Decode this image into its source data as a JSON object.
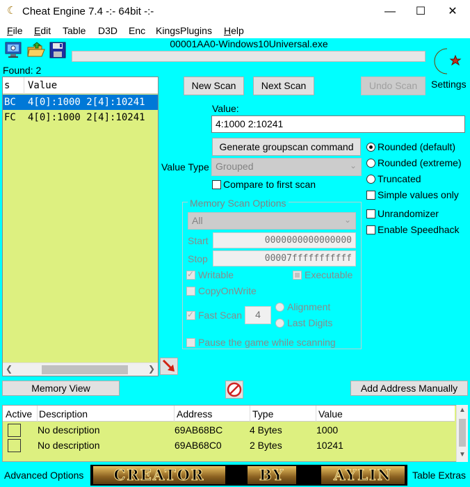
{
  "window": {
    "title": "Cheat Engine 7.4 -:- 64bit -:-",
    "minimize": "—",
    "maximize": "☐",
    "close": "✕"
  },
  "menu": [
    {
      "label": "File",
      "accel": "F",
      "rest": "ile"
    },
    {
      "label": "Edit",
      "accel": "E",
      "rest": "dit"
    },
    {
      "label": "Table",
      "accel": "",
      "rest": "Table"
    },
    {
      "label": "D3D",
      "accel": "",
      "rest": "D3D"
    },
    {
      "label": "Enc",
      "accel": "",
      "rest": "Enc"
    },
    {
      "label": "KingsPlugins",
      "accel": "",
      "rest": "KingsPlugins"
    },
    {
      "label": "Help",
      "accel": "H",
      "rest": "elp"
    }
  ],
  "toolbar": {
    "process_title": "00001AA0-Windows10Universal.exe",
    "settings_label": "Settings"
  },
  "scan": {
    "found_label": "Found: 2",
    "results_headers": [
      "s",
      "Value"
    ],
    "results": [
      {
        "type": "BC",
        "value": "4[0]:1000 2[4]:10241",
        "selected": true
      },
      {
        "type": "FC",
        "value": "4[0]:1000 2[4]:10241",
        "selected": false
      }
    ],
    "new_scan": "New Scan",
    "next_scan": "Next Scan",
    "undo_scan": "Undo Scan",
    "value_label": "Value:",
    "value_input": "4:1000 2:10241",
    "groupscan_btn": "Generate groupscan command",
    "value_type_label": "Value Type",
    "value_type": "Grouped",
    "compare_first": "Compare to first scan",
    "mem_options_title": "Memory Scan Options",
    "mem_region": "All",
    "start_label": "Start",
    "start_value": "0000000000000000",
    "stop_label": "Stop",
    "stop_value": "00007fffffffffff",
    "writable": "Writable",
    "executable": "Executable",
    "copy_on_write": "CopyOnWrite",
    "fast_scan": "Fast Scan",
    "fast_scan_value": "4",
    "alignment": "Alignment",
    "last_digits": "Last Digits",
    "pause_game": "Pause the game while scanning",
    "rounded_default": "Rounded (default)",
    "rounded_extreme": "Rounded (extreme)",
    "truncated": "Truncated",
    "simple_values": "Simple values only",
    "unrandomizer": "Unrandomizer",
    "speedhack": "Enable Speedhack"
  },
  "bottom": {
    "memory_view": "Memory View",
    "add_address": "Add Address Manually",
    "table_headers": [
      "Active",
      "Description",
      "Address",
      "Type",
      "Value"
    ],
    "rows": [
      {
        "description": "No description",
        "address": "69AB68BC",
        "type": "4 Bytes",
        "value": "1000"
      },
      {
        "description": "No description",
        "address": "69AB68C0",
        "type": "2 Bytes",
        "value": "10241"
      }
    ],
    "advanced_options": "Advanced Options",
    "table_extras": "Table Extras",
    "banner_words": [
      "CREATOR",
      "BY",
      "AYLIN"
    ]
  },
  "colors": {
    "background": "#00ffff",
    "list_bg": "#ddf080",
    "selection": "#0078d7"
  }
}
